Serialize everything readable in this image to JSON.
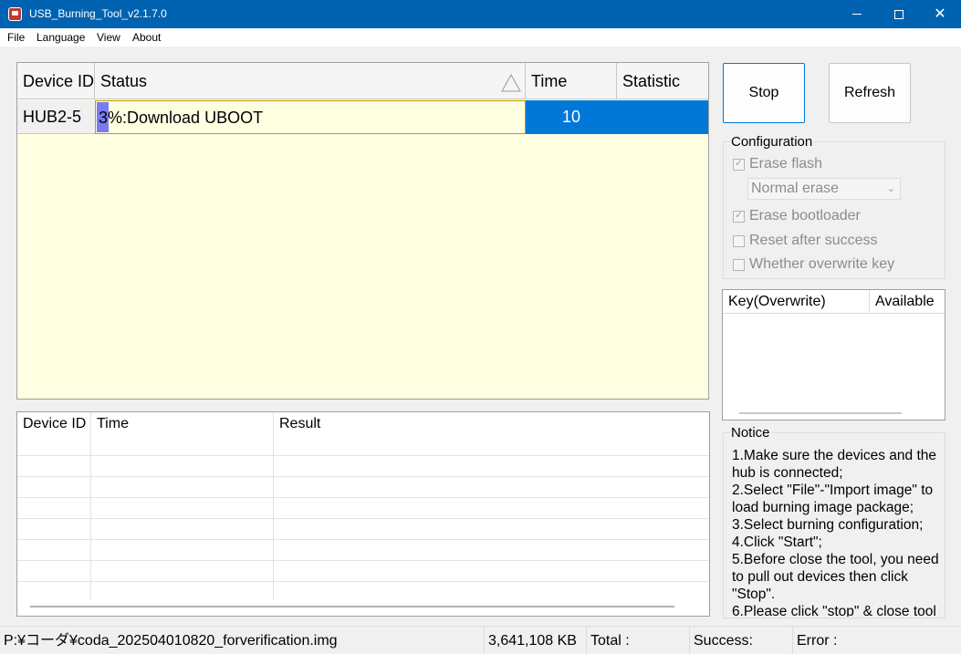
{
  "window": {
    "title": "USB_Burning_Tool_v2.1.7.0",
    "controls": [
      "minimize-icon",
      "maximize-icon",
      "close-icon"
    ],
    "close_glyph": "✕"
  },
  "menu": {
    "items": [
      "File",
      "Language",
      "View",
      "About"
    ]
  },
  "device_table": {
    "columns": [
      "Device ID",
      "Status",
      "Time",
      "Statistic"
    ],
    "sort_icon": "sort-triangle-icon",
    "rows": [
      {
        "device_id": "HUB2-5",
        "status": "3%:Download UBOOT",
        "progress": 3,
        "time": "10",
        "statistic": ""
      }
    ]
  },
  "buttons": {
    "stop": "Stop",
    "refresh": "Refresh"
  },
  "configuration": {
    "title": "Configuration",
    "erase_flash": {
      "label": "Erase flash",
      "checked": true
    },
    "erase_mode": {
      "value": "Normal erase"
    },
    "erase_bootloader": {
      "label": "Erase bootloader",
      "checked": true
    },
    "reset_after_success": {
      "label": "Reset after success",
      "checked": false
    },
    "overwrite_key": {
      "label": "Whether overwrite key",
      "checked": false
    }
  },
  "key_table": {
    "columns": [
      "Key(Overwrite)",
      "Available"
    ]
  },
  "notice": {
    "title": "Notice",
    "lines": [
      "1.Make sure the devices and the hub is connected;",
      "2.Select \"File\"-\"Import image\" to load burning image package;",
      "3.Select burning configuration;",
      "4.Click \"Start\";",
      "5.Before close the tool, you need to pull out devices then click \"Stop\".",
      "6.Please click \"stop\" & close tool"
    ]
  },
  "log_table": {
    "columns": [
      "Device ID",
      "Time",
      "Result"
    ]
  },
  "status_bar": {
    "image_path": "P:¥コーダ¥coda_202504010820_forverification.img",
    "size": "3,641,108 KB",
    "total": "Total :",
    "success": "Success:",
    "error": "Error :"
  },
  "colors": {
    "titlebar": "#0063b1",
    "selected_row": "#0078d7",
    "table_bg": "#ffffe1",
    "progress_fill": "#7b7bf0"
  }
}
